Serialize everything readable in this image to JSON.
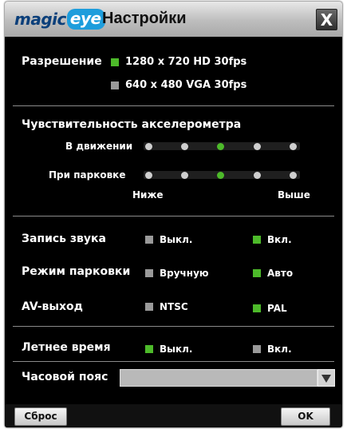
{
  "window": {
    "logo_part1": "magic",
    "logo_part2": "eye",
    "title": "Настройки",
    "close_glyph": "X"
  },
  "resolution": {
    "label": "Разрешение",
    "options": [
      {
        "label": "1280 x 720 HD 30fps",
        "selected": true
      },
      {
        "label": "640 x 480 VGA 30fps",
        "selected": false
      }
    ]
  },
  "accelerometer": {
    "title": "Чувствительность акселерометра",
    "motion_label": "В движении",
    "parking_label": "При парковке",
    "low_label": "Ниже",
    "high_label": "Выше",
    "levels": 5,
    "motion_level": 3,
    "parking_level": 3
  },
  "sound": {
    "label": "Запись звука",
    "off_label": "Выкл.",
    "on_label": "Вкл.",
    "value": "on"
  },
  "parking_mode": {
    "label": "Режим парковки",
    "manual_label": "Вручную",
    "auto_label": "Авто",
    "value": "auto"
  },
  "av_out": {
    "label": "AV-выход",
    "ntsc_label": "NTSC",
    "pal_label": "PAL",
    "value": "pal"
  },
  "dst": {
    "label": "Летнее время",
    "off_label": "Выкл.",
    "on_label": "Вкл.",
    "value": "off"
  },
  "timezone": {
    "label": "Часовой пояс",
    "value": ""
  },
  "footer": {
    "reset_label": "Сброс",
    "ok_label": "OK"
  },
  "colors": {
    "selected": "#4dba2a",
    "unselected": "#9a9a9a"
  }
}
